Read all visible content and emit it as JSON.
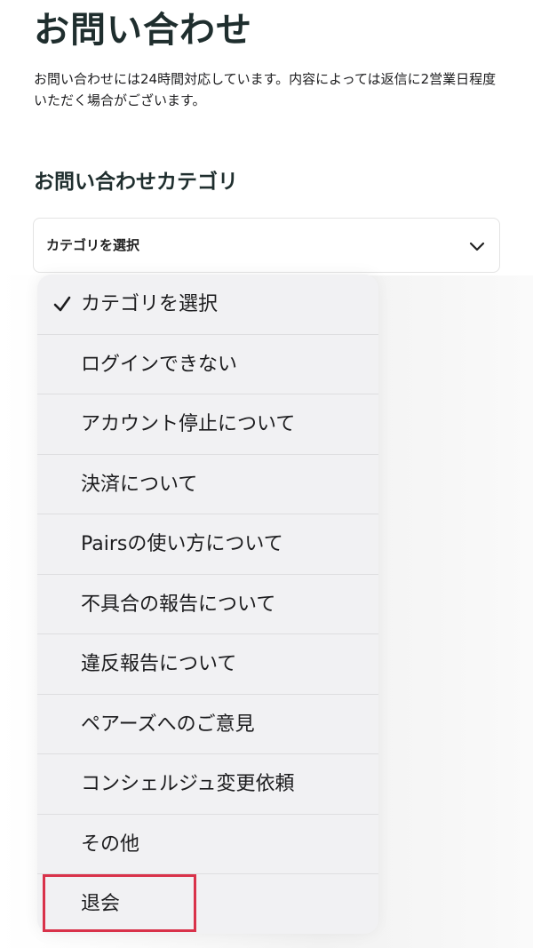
{
  "page": {
    "title": "お問い合わせ",
    "intro": "お問い合わせには24時間対応しています。内容によっては返信に2営業日程度いただく場合がございます。"
  },
  "category": {
    "heading": "お問い合わせカテゴリ",
    "selected_value": "カテゴリを選択",
    "icon": "chevron-down-icon"
  },
  "picker": {
    "options": [
      {
        "label": "カテゴリを選択",
        "selected": true
      },
      {
        "label": "ログインできない",
        "selected": false
      },
      {
        "label": "アカウント停止について",
        "selected": false
      },
      {
        "label": "決済について",
        "selected": false
      },
      {
        "label": "Pairsの使い方について",
        "selected": false
      },
      {
        "label": "不具合の報告について",
        "selected": false
      },
      {
        "label": "違反報告について",
        "selected": false
      },
      {
        "label": "ペアーズへのご意見",
        "selected": false
      },
      {
        "label": "コンシェルジュ変更依頼",
        "selected": false
      },
      {
        "label": "その他",
        "selected": false
      },
      {
        "label": "退会",
        "selected": false
      }
    ],
    "highlighted_option": "退会"
  },
  "colors": {
    "title": "#1f2e2e",
    "picker_background": "#f1f1f3",
    "highlight_border": "#d9324a"
  }
}
